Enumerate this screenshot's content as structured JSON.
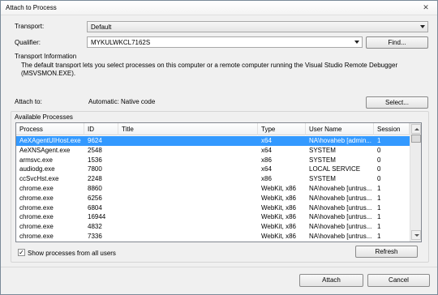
{
  "window": {
    "title": "Attach to Process",
    "close_glyph": "✕"
  },
  "transport": {
    "label": "Transport:",
    "value": "Default"
  },
  "qualifier": {
    "label": "Qualifier:",
    "value": "MYKULWKCL7162S",
    "find_label": "Find..."
  },
  "transport_info": {
    "heading": "Transport Information",
    "line1": "The default transport lets you select processes on this computer or a remote computer running the Visual Studio Remote Debugger",
    "line2": "(MSVSMON.EXE)."
  },
  "attach_to": {
    "label": "Attach to:",
    "value": "Automatic: Native code",
    "select_label": "Select..."
  },
  "available": {
    "heading": "Available Processes",
    "columns": [
      "Process",
      "ID",
      "Title",
      "Type",
      "User Name",
      "Session"
    ],
    "rows": [
      {
        "process": "AeXAgentUIHost.exe",
        "id": "9624",
        "title": "",
        "type": "x64",
        "user": "NA\\hovaheb [admin...",
        "session": "1",
        "selected": true
      },
      {
        "process": "AeXNSAgent.exe",
        "id": "2548",
        "title": "",
        "type": "x64",
        "user": "SYSTEM",
        "session": "0"
      },
      {
        "process": "armsvc.exe",
        "id": "1536",
        "title": "",
        "type": "x86",
        "user": "SYSTEM",
        "session": "0"
      },
      {
        "process": "audiodg.exe",
        "id": "7800",
        "title": "",
        "type": "x64",
        "user": "LOCAL SERVICE",
        "session": "0"
      },
      {
        "process": "ccSvcHst.exe",
        "id": "2248",
        "title": "",
        "type": "x86",
        "user": "SYSTEM",
        "session": "0"
      },
      {
        "process": "chrome.exe",
        "id": "8860",
        "title": "",
        "type": "WebKit, x86",
        "user": "NA\\hovaheb [untrus...",
        "session": "1"
      },
      {
        "process": "chrome.exe",
        "id": "6256",
        "title": "",
        "type": "WebKit, x86",
        "user": "NA\\hovaheb [untrus...",
        "session": "1"
      },
      {
        "process": "chrome.exe",
        "id": "6804",
        "title": "",
        "type": "WebKit, x86",
        "user": "NA\\hovaheb [untrus...",
        "session": "1"
      },
      {
        "process": "chrome.exe",
        "id": "16944",
        "title": "",
        "type": "WebKit, x86",
        "user": "NA\\hovaheb [untrus...",
        "session": "1"
      },
      {
        "process": "chrome.exe",
        "id": "4832",
        "title": "",
        "type": "WebKit, x86",
        "user": "NA\\hovaheb [untrus...",
        "session": "1"
      },
      {
        "process": "chrome.exe",
        "id": "7336",
        "title": "",
        "type": "WebKit, x86",
        "user": "NA\\hovaheb [untrus...",
        "session": "1"
      }
    ],
    "show_all_label": "Show processes from all users",
    "show_all_checked": true,
    "check_glyph": "✓",
    "refresh_label": "Refresh"
  },
  "footer": {
    "attach_label": "Attach",
    "cancel_label": "Cancel"
  },
  "colors": {
    "selection": "#3399ff",
    "dialog_bg": "#f0f0f0"
  }
}
